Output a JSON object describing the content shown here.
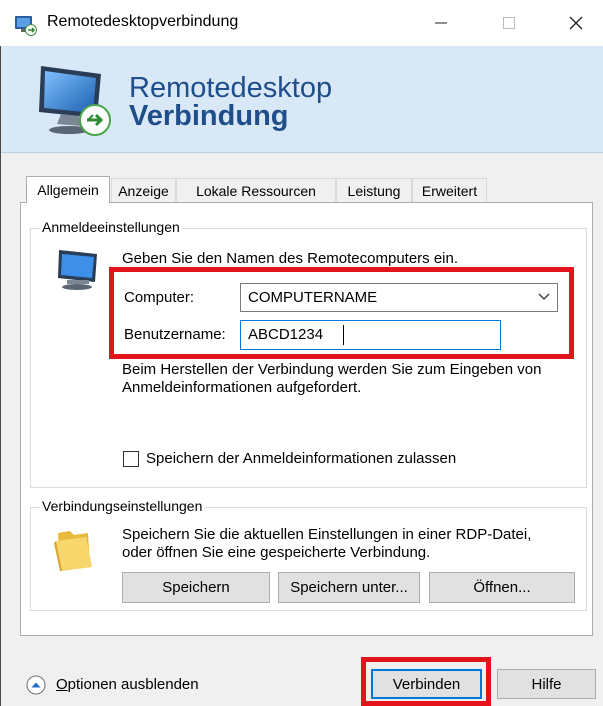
{
  "window": {
    "title": "Remotedesktopverbindung",
    "minimize_glyph": "—",
    "maximize_glyph": "☐",
    "close_glyph": "✕"
  },
  "banner": {
    "line1": "Remotedesktop",
    "line2": "Verbindung",
    "icon": "monitor-remote-icon"
  },
  "tabs": [
    {
      "label": "Allgemein",
      "active": true
    },
    {
      "label": "Anzeige",
      "active": false
    },
    {
      "label": "Lokale Ressourcen",
      "active": false
    },
    {
      "label": "Leistung",
      "active": false
    },
    {
      "label": "Erweitert",
      "active": false
    }
  ],
  "login": {
    "legend": "Anmeldeeinstellungen",
    "instruction": "Geben Sie den Namen des Remotecomputers ein.",
    "computer_label": "Computer:",
    "computer_value": "COMPUTERNAME",
    "username_label": "Benutzername:",
    "username_value": "ABCD1234",
    "info_line1": "Beim Herstellen der Verbindung werden Sie zum Eingeben von",
    "info_line2": "Anmeldeinformationen aufgefordert.",
    "save_credentials_label": "Speichern der Anmeldeinformationen zulassen",
    "save_credentials_checked": false
  },
  "connection": {
    "legend": "Verbindungseinstellungen",
    "text_line1": "Speichern Sie die aktuellen Einstellungen in einer RDP-Datei,",
    "text_line2": "oder öffnen Sie eine gespeicherte Verbindung.",
    "save_button": "Speichern",
    "save_as_button": "Speichern unter...",
    "open_button": "Öffnen..."
  },
  "footer": {
    "options_label_prefix": "O",
    "options_label_rest": "ptionen ausblenden",
    "connect_button": "Verbinden",
    "help_button": "Hilfe"
  },
  "colors": {
    "highlight": "#e3141b",
    "accent": "#0078d7",
    "banner_text": "#1f4e8a"
  }
}
